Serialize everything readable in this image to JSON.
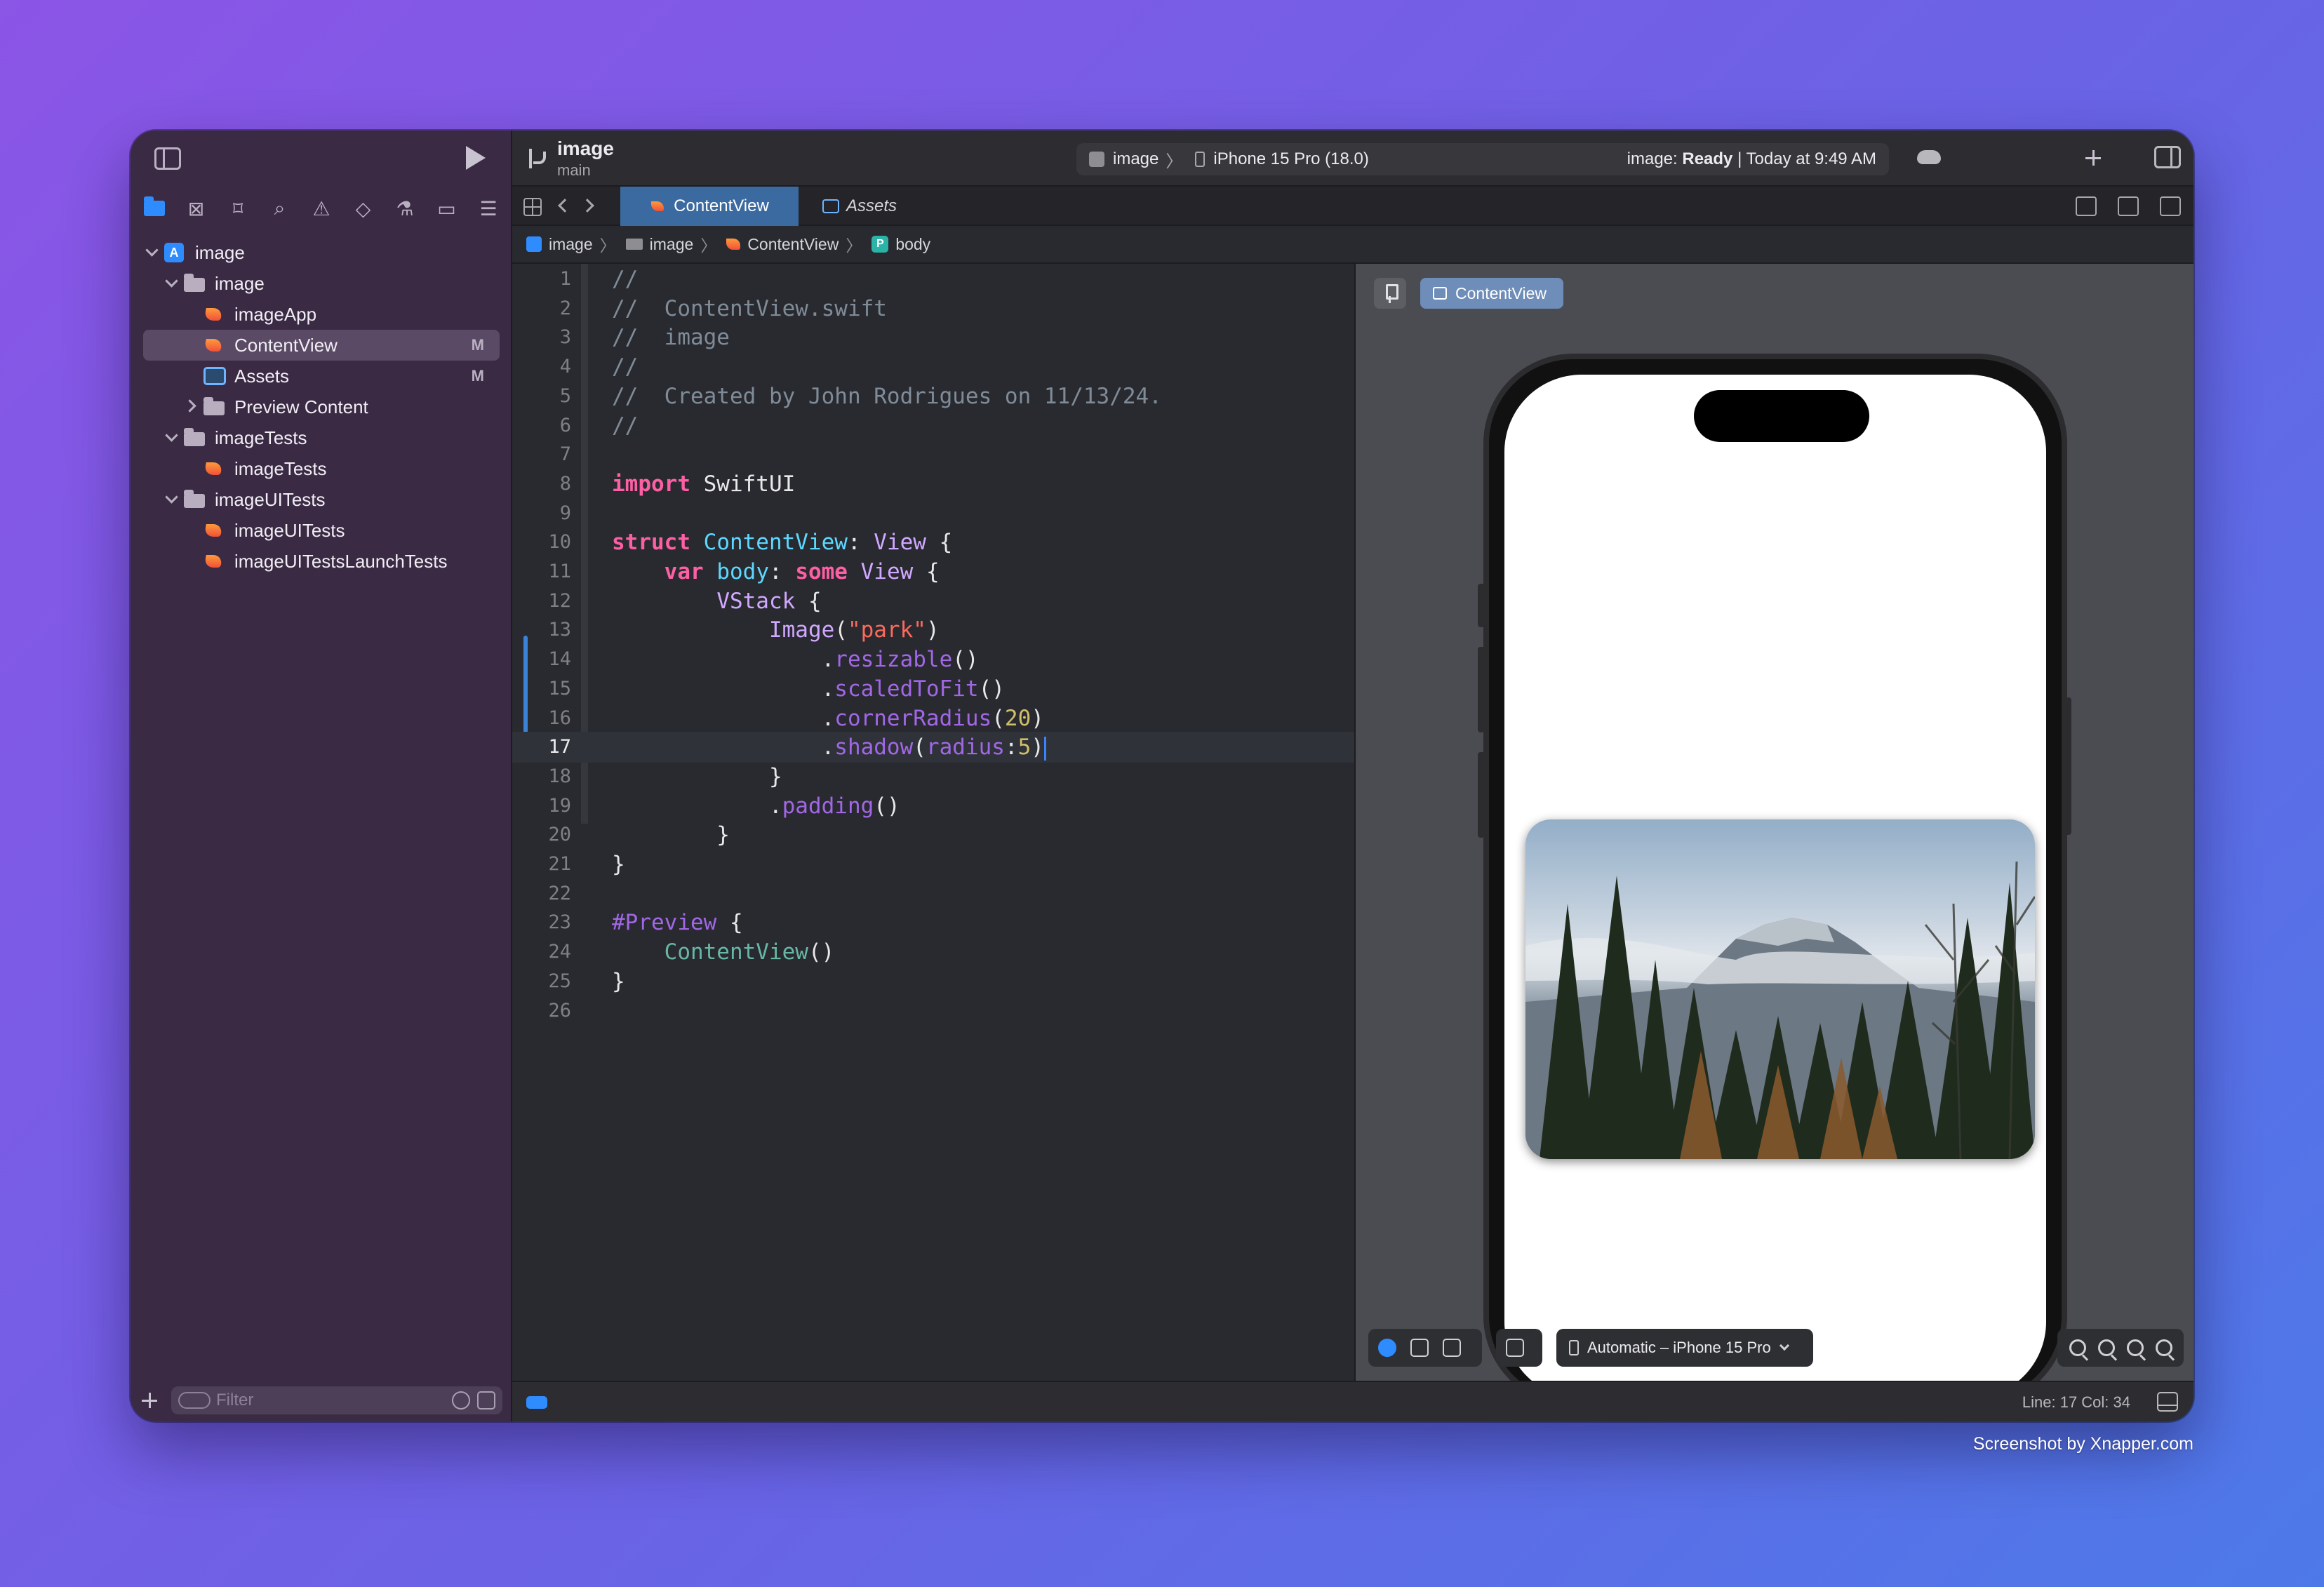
{
  "toolbar": {
    "project_title": "image",
    "branch": "main",
    "scheme_app": "image",
    "scheme_sep": "〉",
    "scheme_device": "iPhone 15 Pro (18.0)",
    "status_prefix": "image: ",
    "status_state": "Ready",
    "status_suffix": " | Today at 9:49 AM"
  },
  "tabs": [
    {
      "label": "ContentView",
      "active": true
    },
    {
      "label": "Assets",
      "active": false
    }
  ],
  "jumpbar": {
    "items": [
      "image",
      "image",
      "ContentView",
      "body"
    ],
    "sep": "〉",
    "prop_letter": "P"
  },
  "navigator": {
    "tree": [
      {
        "label": "image",
        "kind": "project",
        "depth": 0,
        "expanded": true
      },
      {
        "label": "image",
        "kind": "folder",
        "depth": 1,
        "expanded": true
      },
      {
        "label": "imageApp",
        "kind": "swift",
        "depth": 2
      },
      {
        "label": "ContentView",
        "kind": "swift",
        "depth": 2,
        "selected": true,
        "badge": "M"
      },
      {
        "label": "Assets",
        "kind": "assets",
        "depth": 2,
        "badge": "M"
      },
      {
        "label": "Preview Content",
        "kind": "folder",
        "depth": 2,
        "expanded": false
      },
      {
        "label": "imageTests",
        "kind": "folder",
        "depth": 1,
        "expanded": true
      },
      {
        "label": "imageTests",
        "kind": "swift",
        "depth": 2
      },
      {
        "label": "imageUITests",
        "kind": "folder",
        "depth": 1,
        "expanded": true
      },
      {
        "label": "imageUITests",
        "kind": "swift",
        "depth": 2
      },
      {
        "label": "imageUITestsLaunchTests",
        "kind": "swift",
        "depth": 2
      }
    ],
    "filter_placeholder": "Filter"
  },
  "editor": {
    "current_line": 17,
    "lines": [
      [
        [
          "cm",
          "//"
        ]
      ],
      [
        [
          "cm",
          "//  ContentView.swift"
        ]
      ],
      [
        [
          "cm",
          "//  image"
        ]
      ],
      [
        [
          "cm",
          "//"
        ]
      ],
      [
        [
          "cm",
          "//  Created by John Rodrigues on 11/13/24."
        ]
      ],
      [
        [
          "cm",
          "//"
        ]
      ],
      [],
      [
        [
          "kw",
          "import"
        ],
        [
          "pl",
          " SwiftUI"
        ]
      ],
      [],
      [
        [
          "kw",
          "struct"
        ],
        [
          "pl",
          " "
        ],
        [
          "ty",
          "ContentView"
        ],
        [
          "pl",
          ": "
        ],
        [
          "ty2",
          "View"
        ],
        [
          "pl",
          " {"
        ]
      ],
      [
        [
          "pl",
          "    "
        ],
        [
          "kw",
          "var"
        ],
        [
          "pl",
          " "
        ],
        [
          "ty",
          "body"
        ],
        [
          "pl",
          ": "
        ],
        [
          "kw",
          "some"
        ],
        [
          "pl",
          " "
        ],
        [
          "ty2",
          "View"
        ],
        [
          "pl",
          " {"
        ]
      ],
      [
        [
          "pl",
          "        "
        ],
        [
          "ty2",
          "VStack"
        ],
        [
          "pl",
          " {"
        ]
      ],
      [
        [
          "pl",
          "            "
        ],
        [
          "ty2",
          "Image"
        ],
        [
          "pl",
          "("
        ],
        [
          "str",
          "\"park\""
        ],
        [
          "pl",
          ")"
        ]
      ],
      [
        [
          "pl",
          "                ."
        ],
        [
          "fn",
          "resizable"
        ],
        [
          "pl",
          "()"
        ]
      ],
      [
        [
          "pl",
          "                ."
        ],
        [
          "fn",
          "scaledToFit"
        ],
        [
          "pl",
          "()"
        ]
      ],
      [
        [
          "pl",
          "                ."
        ],
        [
          "fn",
          "cornerRadius"
        ],
        [
          "pl",
          "("
        ],
        [
          "num",
          "20"
        ],
        [
          "pl",
          ")"
        ]
      ],
      [
        [
          "pl",
          "                ."
        ],
        [
          "fn",
          "shadow"
        ],
        [
          "pl",
          "("
        ],
        [
          "fn",
          "radius"
        ],
        [
          "pl",
          ":"
        ],
        [
          "num",
          "5"
        ],
        [
          "pl",
          ")"
        ]
      ],
      [
        [
          "pl",
          "            }"
        ]
      ],
      [
        [
          "pl",
          "            ."
        ],
        [
          "fn",
          "padding"
        ],
        [
          "pl",
          "()"
        ]
      ],
      [
        [
          "pl",
          "        }"
        ]
      ],
      [
        [
          "pl",
          "}"
        ]
      ],
      [],
      [
        [
          "fn",
          "#Preview"
        ],
        [
          "pl",
          " {"
        ]
      ],
      [
        [
          "pl",
          "    "
        ],
        [
          "fn2",
          "ContentView"
        ],
        [
          "pl",
          "()"
        ]
      ],
      [
        [
          "pl",
          "}"
        ]
      ],
      []
    ]
  },
  "preview": {
    "chip_label": "ContentView",
    "device_select": "Automatic – iPhone 15 Pro"
  },
  "statusbar": {
    "line_col": "Line: 17  Col: 34"
  },
  "watermark": "Screenshot by Xnapper.com"
}
